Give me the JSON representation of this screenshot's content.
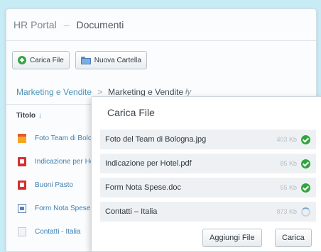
{
  "header": {
    "app": "HR Portal",
    "separator": "–",
    "section": "Documenti"
  },
  "toolbar": {
    "upload_label": "Carica File",
    "new_folder_label": "Nuova Cartella"
  },
  "path": {
    "parent": "Marketing e Vendite",
    "arrow": ">",
    "current": "Marketing e Vendite",
    "cursor_glyph": "ły"
  },
  "table": {
    "column_title": "Titolo",
    "sort_glyph": "↓"
  },
  "files": [
    {
      "name": "Foto Team di Bologna",
      "icon": "image-file-icon"
    },
    {
      "name": "Indicazione per Hotel",
      "icon": "pdf-file-icon"
    },
    {
      "name": "Buoni Pasto",
      "icon": "pdf-file-icon"
    },
    {
      "name": "Form Nota Spese",
      "icon": "doc-file-icon"
    },
    {
      "name": "Contatti - Italia",
      "icon": "blank-file-icon"
    }
  ],
  "dialog": {
    "title": "Carica File",
    "uploads": [
      {
        "name": "Foto del Team di Bologna.jpg",
        "size": "403 Kb",
        "status": "done"
      },
      {
        "name": "Indicazione per Hotel.pdf",
        "size": "85 Kb",
        "status": "done"
      },
      {
        "name": "Form Nota Spese.doc",
        "size": "55 Kb",
        "status": "done"
      },
      {
        "name": "Contatti – Italia",
        "size": "873 Kb",
        "status": "uploading"
      }
    ],
    "add_label": "Aggiungi File",
    "upload_label": "Carica"
  },
  "colors": {
    "background": "#c8ecf6",
    "accent": "#4d91b7",
    "success": "#2fa63c"
  }
}
